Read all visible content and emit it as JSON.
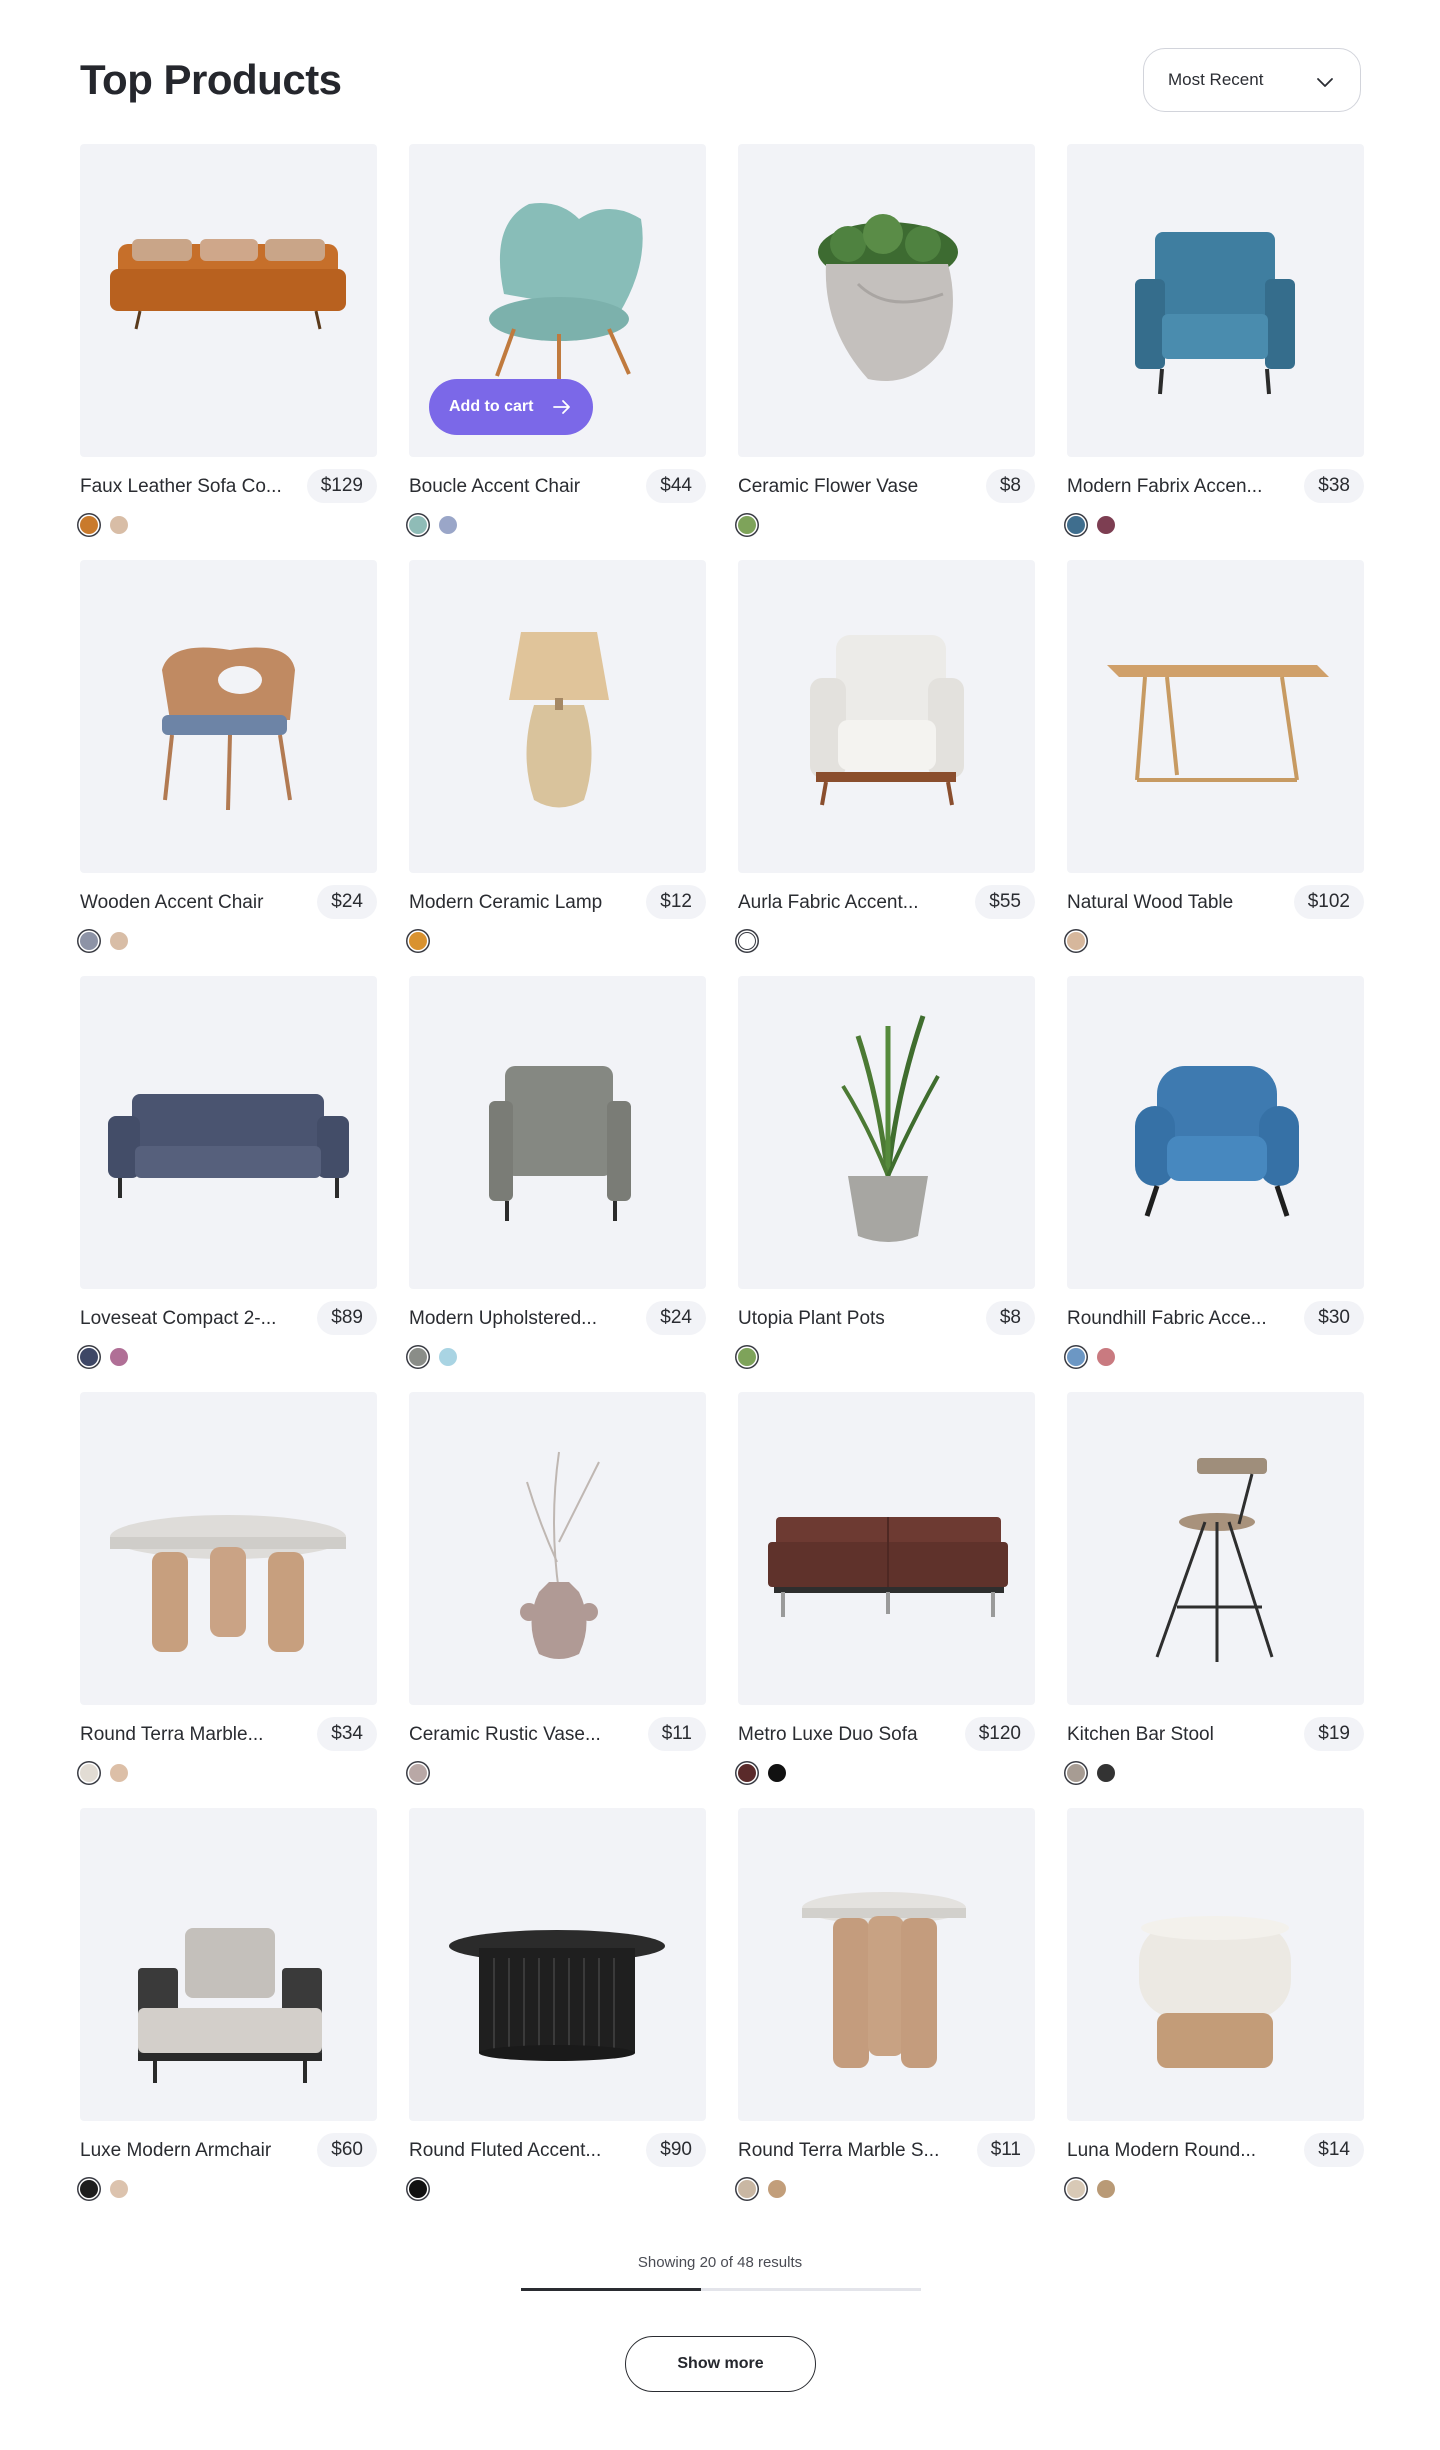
{
  "header": {
    "title": "Top Products",
    "sort": {
      "selected": "Most Recent",
      "icon": "chevron-down-icon"
    }
  },
  "hover_action": {
    "label": "Add to cart",
    "icon": "arrow-right-icon"
  },
  "products": [
    {
      "name": "Faux Leather Sofa Co...",
      "price": "$129",
      "swatches": [
        "#c97a2c",
        "#d8bda6"
      ]
    },
    {
      "name": "Boucle Accent Chair",
      "price": "$44",
      "swatches": [
        "#8fbcb7",
        "#9aa6c8"
      ]
    },
    {
      "name": "Ceramic Flower Vase",
      "price": "$8",
      "swatches": [
        "#7ea35a"
      ]
    },
    {
      "name": "Modern Fabrix Accen...",
      "price": "$38",
      "swatches": [
        "#3f6e8e",
        "#7d3e52"
      ]
    },
    {
      "name": "Wooden Accent Chair",
      "price": "$24",
      "swatches": [
        "#8d93a6",
        "#d8bda6"
      ]
    },
    {
      "name": "Modern Ceramic Lamp",
      "price": "$12",
      "swatches": [
        "#d9922f"
      ]
    },
    {
      "name": "Aurla Fabric Accent...",
      "price": "$55",
      "swatches": [
        "#ffffff"
      ]
    },
    {
      "name": "Natural Wood Table",
      "price": "$102",
      "swatches": [
        "#d6b79c"
      ]
    },
    {
      "name": "Loveseat Compact 2-...",
      "price": "$89",
      "swatches": [
        "#3e4766",
        "#b06f96"
      ]
    },
    {
      "name": "Modern Upholstered...",
      "price": "$24",
      "swatches": [
        "#8a8d88",
        "#a9d4e3"
      ]
    },
    {
      "name": "Utopia Plant Pots",
      "price": "$8",
      "swatches": [
        "#7ea35a"
      ]
    },
    {
      "name": "Roundhill Fabric Acce...",
      "price": "$30",
      "swatches": [
        "#6c97c4",
        "#c97a80"
      ]
    },
    {
      "name": "Round Terra Marble...",
      "price": "$34",
      "swatches": [
        "#e2dcd4",
        "#dcbfa7"
      ]
    },
    {
      "name": "Ceramic Rustic Vase...",
      "price": "$11",
      "swatches": [
        "#b9a8a6"
      ]
    },
    {
      "name": "Metro Luxe Duo Sofa",
      "price": "$120",
      "swatches": [
        "#5a2a2a",
        "#111111"
      ]
    },
    {
      "name": "Kitchen Bar Stool",
      "price": "$19",
      "swatches": [
        "#a79c93",
        "#333333"
      ]
    },
    {
      "name": "Luxe Modern Armchair",
      "price": "$60",
      "swatches": [
        "#1e1e1e",
        "#dcc3ae"
      ]
    },
    {
      "name": "Round Fluted Accent...",
      "price": "$90",
      "swatches": [
        "#111111"
      ]
    },
    {
      "name": "Round Terra Marble S...",
      "price": "$11",
      "swatches": [
        "#c9b7a3",
        "#c29e7a"
      ]
    },
    {
      "name": "Luna Modern Round...",
      "price": "$14",
      "swatches": [
        "#d8c9b6",
        "#b99a76"
      ]
    }
  ],
  "footer": {
    "results_text": "Showing 20 of 48 results",
    "progress": 0.45,
    "show_more_label": "Show more"
  },
  "colors": {
    "accent": "#7b68e8",
    "card_bg": "#f2f3f7",
    "text": "#25272d"
  }
}
